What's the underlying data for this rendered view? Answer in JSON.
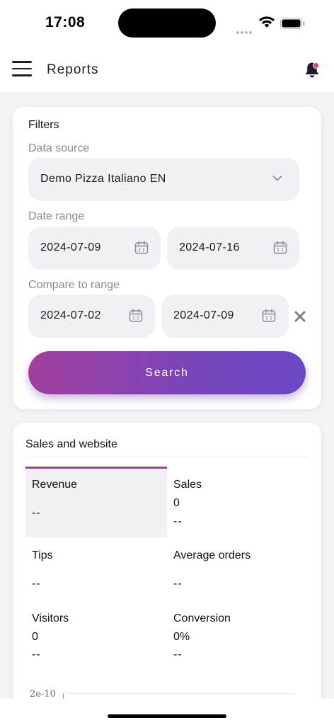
{
  "status_bar": {
    "time": "17:08"
  },
  "header": {
    "title": "Reports"
  },
  "filters": {
    "title": "Filters",
    "data_source_label": "Data source",
    "data_source_value": "Demo Pizza Italiano EN",
    "date_range_label": "Date range",
    "date_from": "2024-07-09",
    "date_to": "2024-07-16",
    "compare_label": "Compare to range",
    "compare_from": "2024-07-02",
    "compare_to": "2024-07-09",
    "search_label": "Search"
  },
  "sales": {
    "title": "Sales and website",
    "metrics": [
      {
        "label": "Revenue",
        "value": "",
        "sub": "--"
      },
      {
        "label": "Sales",
        "value": "0",
        "sub": "--"
      },
      {
        "label": "Tips",
        "value": "",
        "sub": "--"
      },
      {
        "label": "Average orders",
        "value": "",
        "sub": "--"
      },
      {
        "label": "Visitors",
        "value": "0",
        "sub": "--"
      },
      {
        "label": "Conversion",
        "value": "0%",
        "sub": "--"
      }
    ],
    "chart_axis_label": "2e-10"
  },
  "colors": {
    "accent_start": "#a23f9c",
    "accent_end": "#6a48c4",
    "notification_dot": "#ee3b5a",
    "field_background": "#f0f0f5"
  }
}
